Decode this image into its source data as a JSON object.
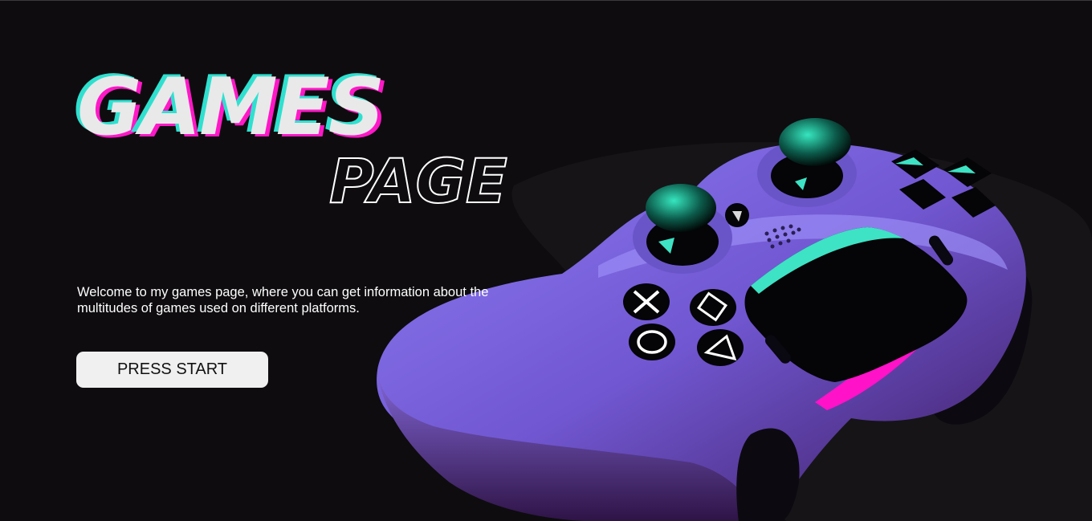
{
  "hero": {
    "title": "GAMES",
    "subtitle": "PAGE",
    "description": "Welcome to my games page, where you can get information about the multitudes of games used on different platforms.",
    "start_button": "PRESS START"
  },
  "colors": {
    "background": "#0e0c0f",
    "accent_cyan": "#2fe0cf",
    "accent_magenta": "#ff18c6",
    "controller_purple": "#7a66e0"
  },
  "icons": [
    "gamepad-controller-illustration"
  ]
}
